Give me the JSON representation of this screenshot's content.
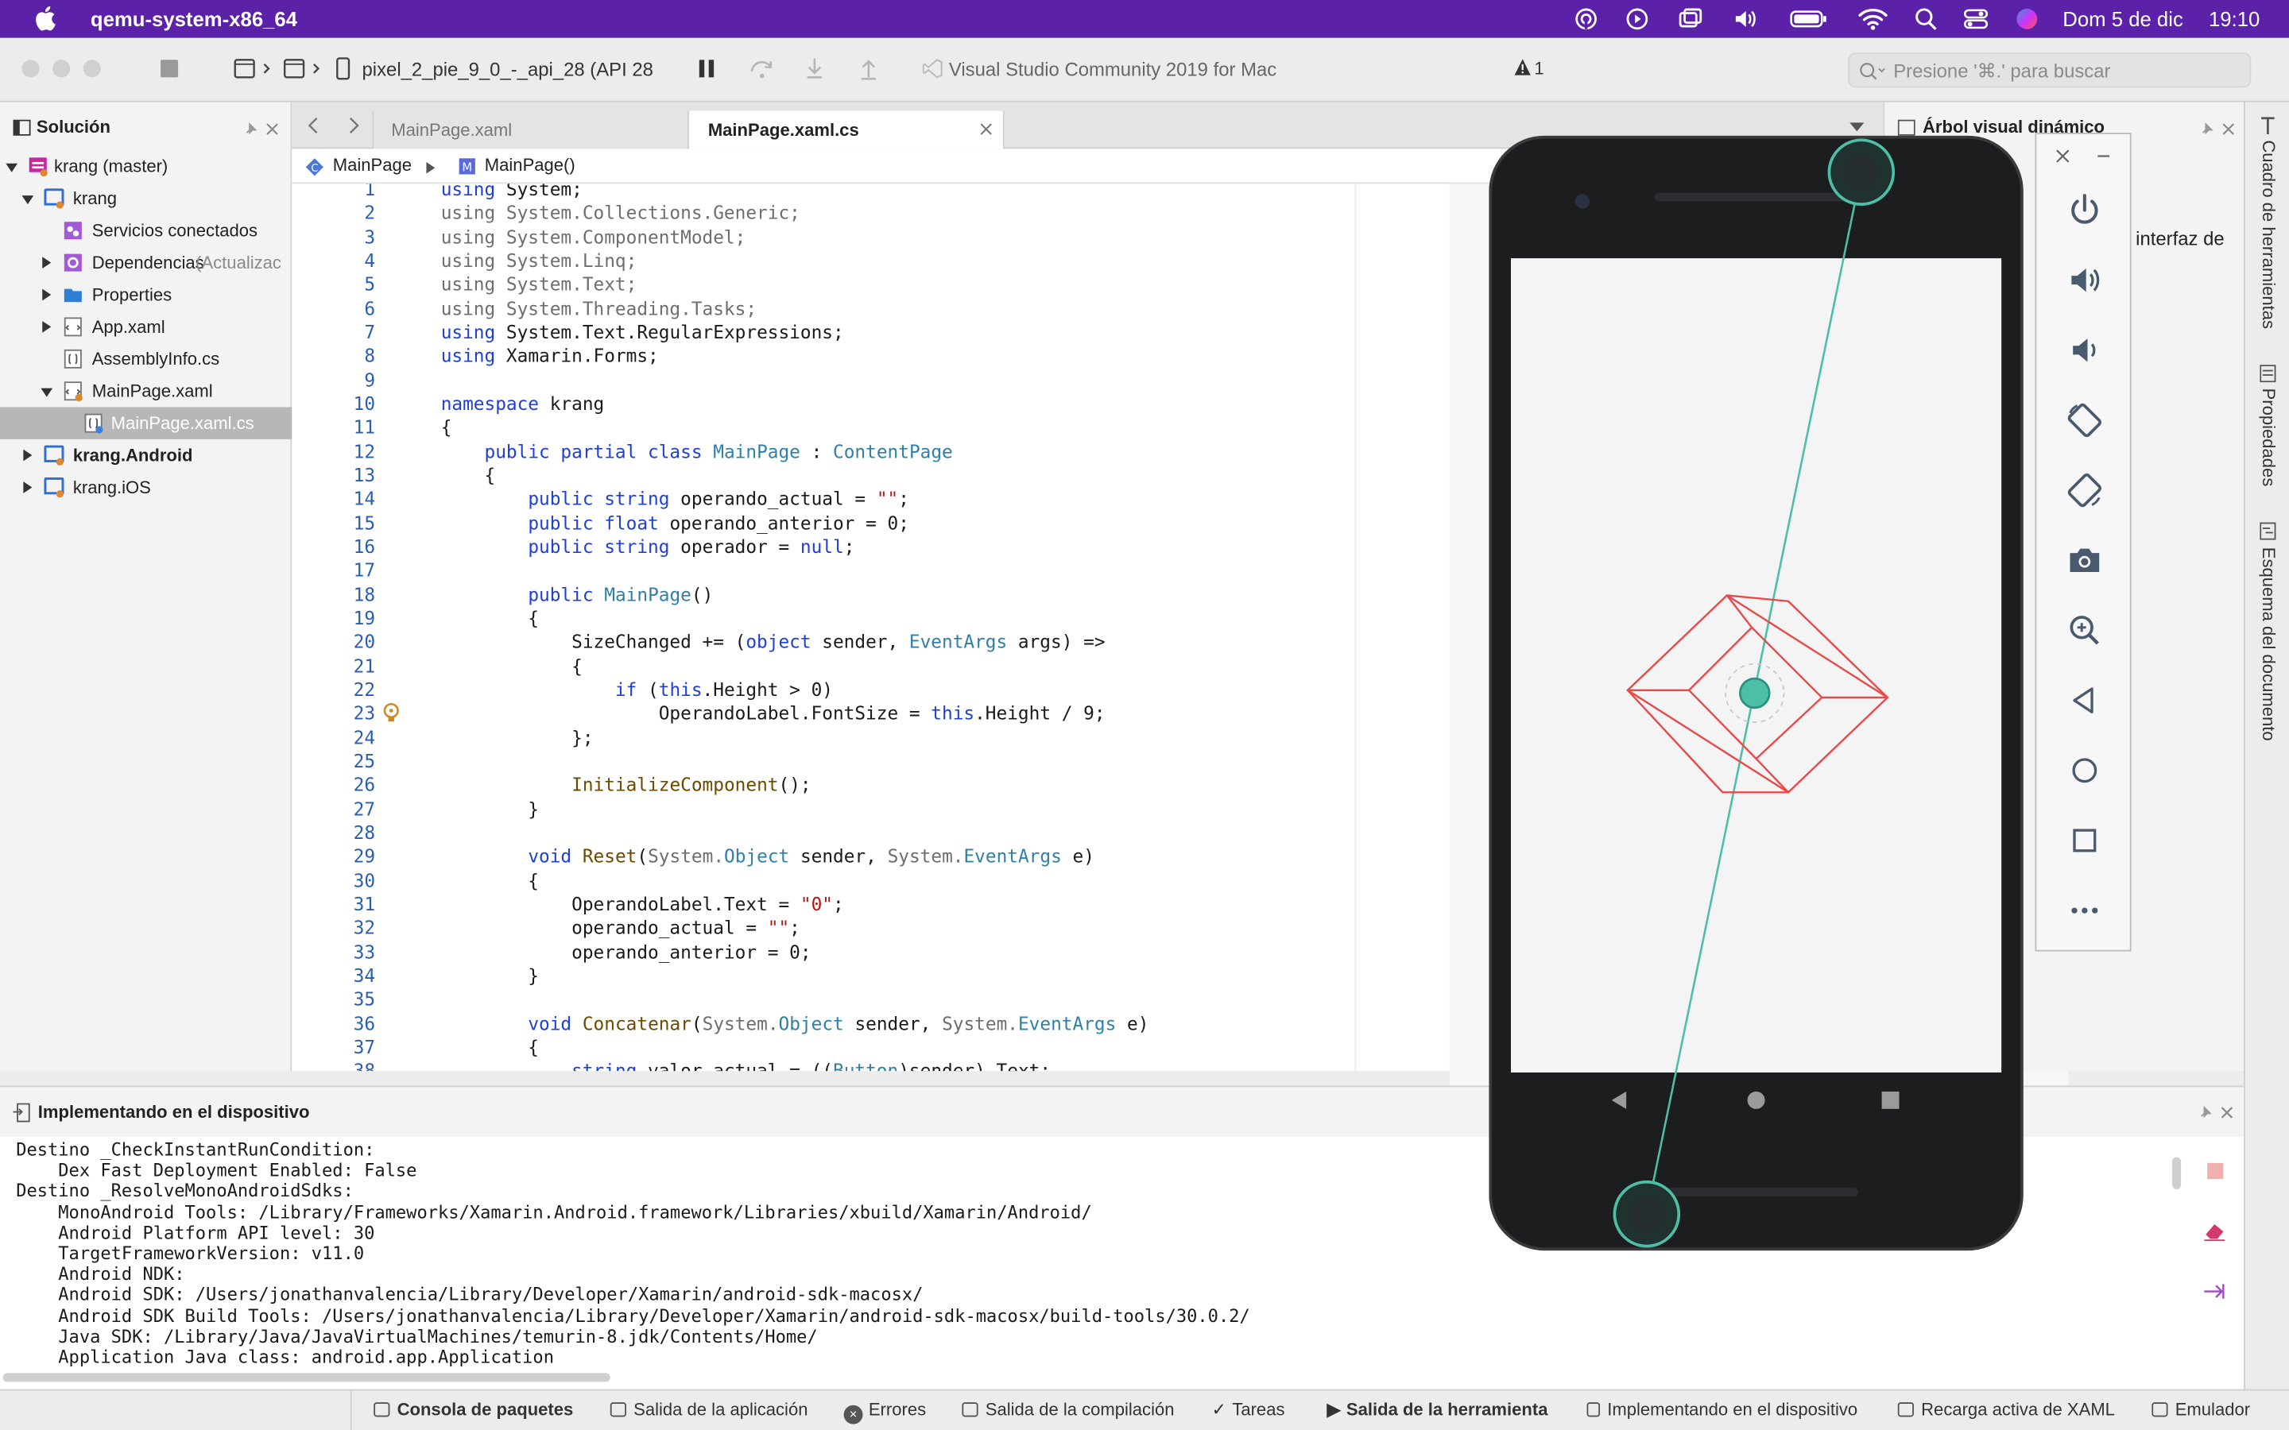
{
  "menubar": {
    "app_name": "qemu-system-x86_64",
    "date": "Dom 5 de dic",
    "time": "19:10"
  },
  "toolbar": {
    "device": "pixel_2_pie_9_0_-_api_28 (API 28",
    "ide_title": "Visual Studio Community 2019 for Mac",
    "warning_count": "1",
    "search_placeholder": "Presione '⌘.' para buscar"
  },
  "solution": {
    "title": "Solución",
    "items": [
      {
        "label": "krang (master)"
      },
      {
        "label": "krang"
      },
      {
        "label": "Servicios conectados"
      },
      {
        "label": "Dependencias",
        "note": "(Actualizac"
      },
      {
        "label": "Properties"
      },
      {
        "label": "App.xaml"
      },
      {
        "label": "AssemblyInfo.cs"
      },
      {
        "label": "MainPage.xaml"
      },
      {
        "label": "MainPage.xaml.cs"
      },
      {
        "label": "krang.Android"
      },
      {
        "label": "krang.iOS"
      }
    ]
  },
  "editor": {
    "tabs": [
      {
        "label": "MainPage.xaml"
      },
      {
        "label": "MainPage.xaml.cs"
      }
    ],
    "breadcrumb": [
      "MainPage",
      "MainPage()"
    ],
    "line_numbers": [
      "1",
      "2",
      "3",
      "4",
      "5",
      "6",
      "7",
      "8",
      "9",
      "10",
      "11",
      "12",
      "13",
      "14",
      "15",
      "16",
      "17",
      "18",
      "19",
      "20",
      "21",
      "22",
      "23",
      "24",
      "25",
      "26",
      "27",
      "28",
      "29",
      "30",
      "31",
      "32",
      "33",
      "34",
      "35",
      "36",
      "37",
      "38"
    ]
  },
  "dynamic_tree": {
    "title": "Árbol visual dinámico",
    "partial_text": "interfaz de"
  },
  "right_strip": [
    "Cuadro de herramientas",
    "Propiedades",
    "Esquema del documento"
  ],
  "output": {
    "title": "Implementando en el dispositivo",
    "lines": [
      "Destino _CheckInstantRunCondition:",
      "    Dex Fast Deployment Enabled: False",
      "Destino _ResolveMonoAndroidSdks:",
      "    MonoAndroid Tools: /Library/Frameworks/Xamarin.Android.framework/Libraries/xbuild/Xamarin/Android/",
      "    Android Platform API level: 30",
      "    TargetFrameworkVersion: v11.0",
      "    Android NDK:",
      "    Android SDK: /Users/jonathanvalencia/Library/Developer/Xamarin/android-sdk-macosx/",
      "    Android SDK Build Tools: /Users/jonathanvalencia/Library/Developer/Xamarin/android-sdk-macosx/build-tools/30.0.2/",
      "    Java SDK: /Library/Java/JavaVirtualMachines/temurin-8.jdk/Contents/Home/",
      "    Application Java class: android.app.Application"
    ]
  },
  "statusbar": {
    "items": [
      "Consola de paquetes",
      "Salida de la aplicación",
      "Errores",
      "Salida de la compilación",
      "Tareas",
      "Salida de la herramienta",
      "Implementando en el dispositivo",
      "Recarga activa de XAML",
      "Emulador"
    ]
  },
  "colors": {
    "menubar": "#5b21a8",
    "keyword": "#1f3fd6",
    "type": "#2f7fa8",
    "string": "#b01818",
    "teal": "#4dbfa9",
    "red": "#e84a4a"
  }
}
